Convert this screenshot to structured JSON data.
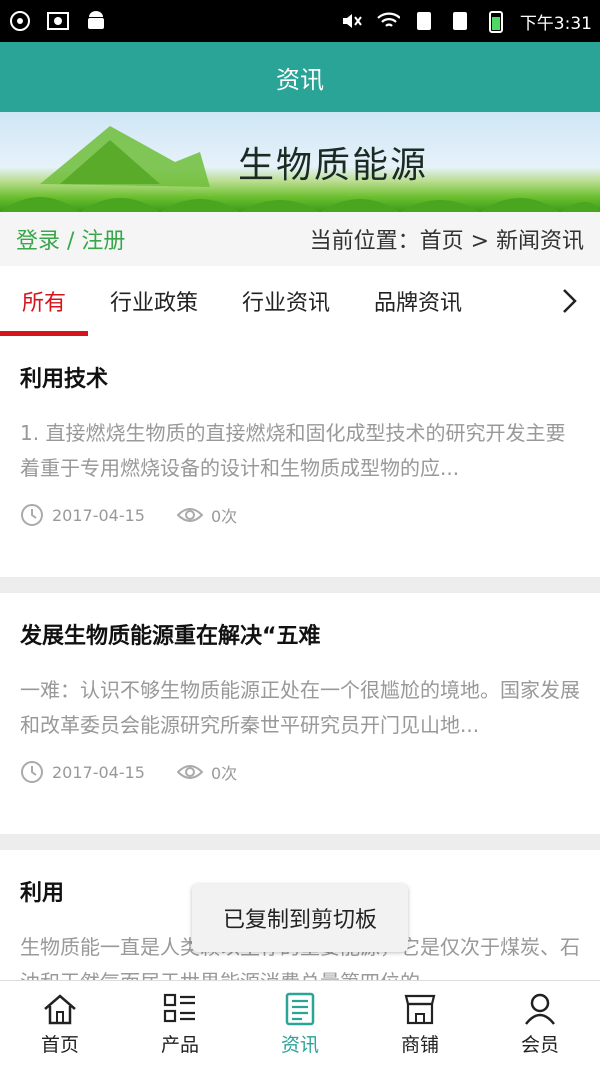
{
  "status": {
    "time": "下午3:31"
  },
  "header": {
    "title": "资讯"
  },
  "banner": {
    "title": "生物质能源"
  },
  "crumb": {
    "login": "登录 / 注册",
    "location": "当前位置：首页 > 新闻资讯"
  },
  "tabs": [
    {
      "label": "所有"
    },
    {
      "label": "行业政策"
    },
    {
      "label": "行业资讯"
    },
    {
      "label": "品牌资讯"
    }
  ],
  "articles": [
    {
      "title": "利用技术",
      "desc": "1. 直接燃烧生物质的直接燃烧和固化成型技术的研究开发主要着重于专用燃烧设备的设计和生物质成型物的应...",
      "date": "2017-04-15",
      "views": "0次"
    },
    {
      "title": "发展生物质能源重在解决“五难",
      "desc": "一难：认识不够生物质能源正处在一个很尴尬的境地。国家发展和改革委员会能源研究所秦世平研究员开门见山地...",
      "date": "2017-04-15",
      "views": "0次"
    },
    {
      "title": "利用",
      "desc": "生物质能一直是人类赖以生存的重要能源，它是仅次于煤炭、石油和天然气而居于世界能源消费总量第四位的"
    }
  ],
  "toast": {
    "text": "已复制到剪切板"
  },
  "nav": [
    {
      "label": "首页",
      "icon": "home-icon"
    },
    {
      "label": "产品",
      "icon": "grid-list-icon"
    },
    {
      "label": "资讯",
      "icon": "news-icon"
    },
    {
      "label": "商铺",
      "icon": "shop-icon"
    },
    {
      "label": "会员",
      "icon": "user-icon"
    }
  ],
  "colors": {
    "primary": "#2aa496",
    "active_tab": "#d6141b",
    "login": "#3aa64b"
  }
}
